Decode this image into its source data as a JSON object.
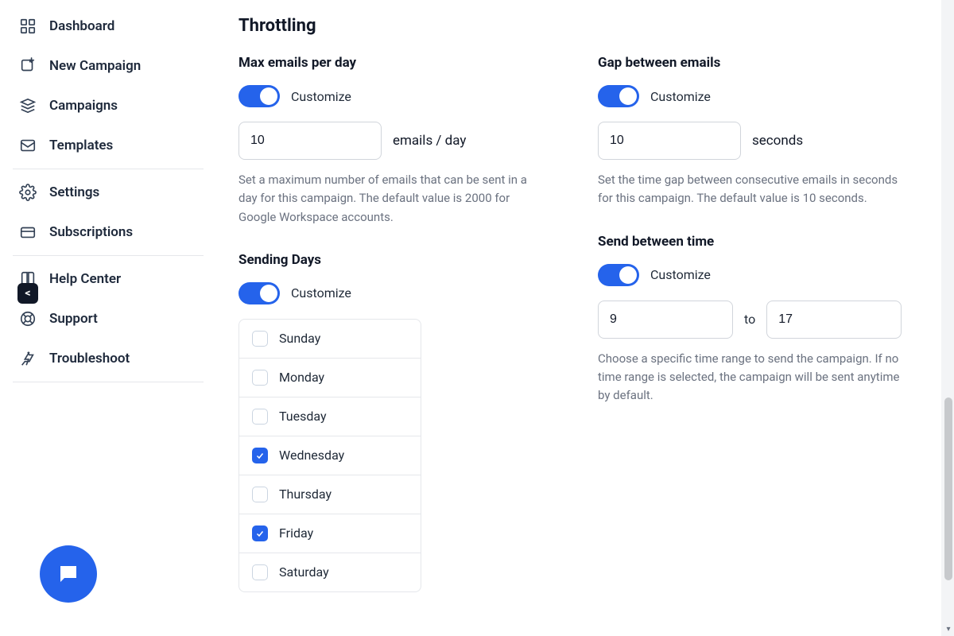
{
  "sidebar": {
    "items": [
      {
        "label": "Dashboard",
        "icon": "dashboard"
      },
      {
        "label": "New Campaign",
        "icon": "new-campaign"
      },
      {
        "label": "Campaigns",
        "icon": "campaigns"
      },
      {
        "label": "Templates",
        "icon": "templates"
      },
      {
        "label": "Settings",
        "icon": "settings"
      },
      {
        "label": "Subscriptions",
        "icon": "subscriptions"
      },
      {
        "label": "Help Center",
        "icon": "help-center"
      },
      {
        "label": "Support",
        "icon": "support"
      },
      {
        "label": "Troubleshoot",
        "icon": "troubleshoot"
      }
    ]
  },
  "throttling": {
    "title": "Throttling",
    "max_per_day": {
      "title": "Max emails per day",
      "customize_label": "Customize",
      "customize_on": true,
      "value": "10",
      "unit": "emails / day",
      "helper": "Set a maximum number of emails that can be sent in a day for this campaign. The default value is 2000 for Google Workspace accounts."
    },
    "gap": {
      "title": "Gap between emails",
      "customize_label": "Customize",
      "customize_on": true,
      "value": "10",
      "unit": "seconds",
      "helper": "Set the time gap between consecutive emails in seconds for this campaign. The default value is 10 seconds."
    },
    "sending_days": {
      "title": "Sending Days",
      "customize_label": "Customize",
      "customize_on": true,
      "days": [
        {
          "label": "Sunday",
          "checked": false
        },
        {
          "label": "Monday",
          "checked": false
        },
        {
          "label": "Tuesday",
          "checked": false
        },
        {
          "label": "Wednesday",
          "checked": true
        },
        {
          "label": "Thursday",
          "checked": false
        },
        {
          "label": "Friday",
          "checked": true
        },
        {
          "label": "Saturday",
          "checked": false
        }
      ]
    },
    "send_between": {
      "title": "Send between time",
      "customize_label": "Customize",
      "customize_on": true,
      "from": "9",
      "sep": "to",
      "to": "17",
      "helper": "Choose a specific time range to send the campaign. If no time range is selected, the campaign will be sent anytime by default."
    }
  },
  "collapse_handle": "<"
}
